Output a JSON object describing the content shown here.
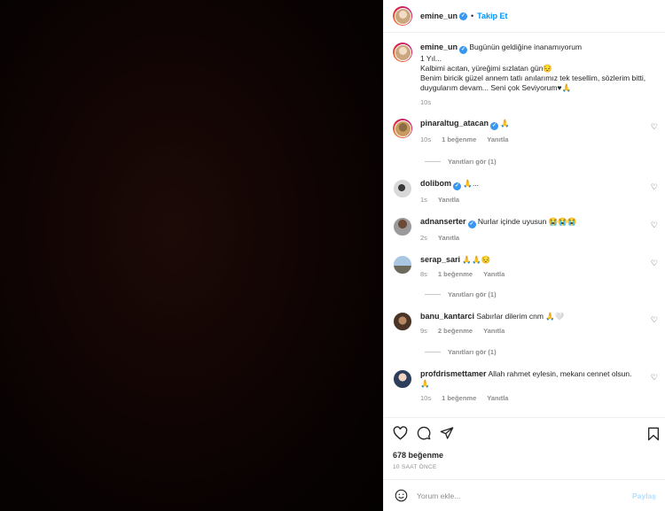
{
  "header": {
    "username": "emine_un",
    "separator": "•",
    "follow_label": "Takip Et"
  },
  "caption": {
    "username": "emine_un",
    "line1": "Bugünün geldiğine inanamıyorum",
    "line2": "1 Yıl...",
    "line3": "Kalbimi acıtan, yüreğimi sızlatan gün😔",
    "line4": "Benim biricik güzel annem tatlı anılarımız tek tesellim, sözlerim bitti, duygularım devam... Seni çok Seviyorum♥🙏",
    "time": "10s"
  },
  "comments": [
    {
      "username": "pinaraltug_atacan",
      "text": "🙏",
      "time": "10s",
      "likes": "1 beğenme",
      "reply": "Yanıtla"
    },
    {
      "username": "dolibom",
      "text": "🙏...",
      "time": "1s",
      "likes": "",
      "reply": "Yanıtla"
    },
    {
      "username": "adnanserter",
      "text": "Nurlar içinde uyusun 😭😭😭",
      "time": "2s",
      "likes": "",
      "reply": "Yanıtla"
    },
    {
      "username": "serap_sari",
      "text": "🙏🙏😔",
      "time": "8s",
      "likes": "1 beğenme",
      "reply": "Yanıtla"
    },
    {
      "username": "banu_kantarci",
      "text": "Sabırlar dilerim cnm 🙏🤍",
      "time": "9s",
      "likes": "2 beğenme",
      "reply": "Yanıtla"
    },
    {
      "username": "profdrismettamer",
      "text": "Allah rahmet eylesin, mekanı cennet olsun. 🙏",
      "time": "10s",
      "likes": "1 beğenme",
      "reply": "Yanıtla"
    }
  ],
  "replies": [
    {
      "label": "Yanıtları gör (1)"
    },
    {
      "label": "Yanıtları gör (1)"
    },
    {
      "label": "Yanıtları gör (1)"
    }
  ],
  "actions": {
    "icons": [
      "heart-icon",
      "comment-icon",
      "share-icon",
      "bookmark-icon"
    ]
  },
  "likes_count": "678 beğenme",
  "post_time": "10 SAAT ÖNCE",
  "add_comment": {
    "placeholder": "Yorum ekle...",
    "post_label": "Paylaş"
  },
  "colors": {
    "accent": "#0095f6",
    "verified": "#3897f0",
    "muted": "#8e8e8e"
  }
}
